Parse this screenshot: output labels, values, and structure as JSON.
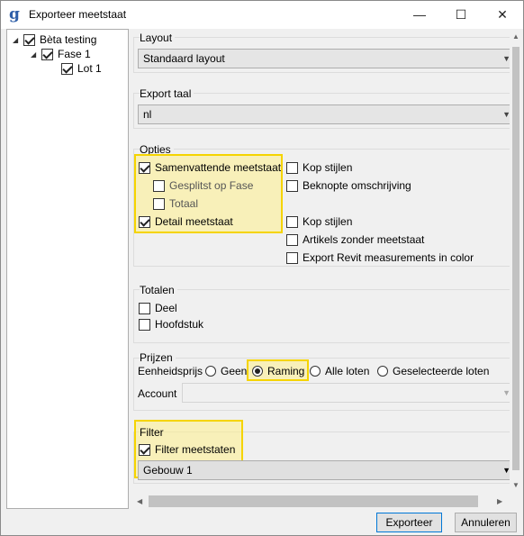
{
  "window": {
    "title": "Exporteer meetstaat",
    "icon": "g-app-icon",
    "controls": {
      "minimize": "—",
      "maximize": "☐",
      "close": "✕"
    }
  },
  "tree": {
    "items": [
      {
        "label": "Bèta testing",
        "checked": true,
        "expanded": true
      },
      {
        "label": "Fase 1",
        "checked": true,
        "expanded": true
      },
      {
        "label": "Lot 1",
        "checked": true
      }
    ]
  },
  "layout": {
    "label": "Layout",
    "selected": "Standaard layout"
  },
  "export_language": {
    "label": "Export taal",
    "selected": "nl"
  },
  "options": {
    "label": "Opties",
    "left": [
      {
        "label": "Samenvattende meetstaat",
        "checked": true
      },
      {
        "label": "Gesplitst op Fase",
        "checked": false,
        "disabled": true
      },
      {
        "label": "Totaal",
        "checked": false,
        "disabled": true
      },
      {
        "label": "Detail meetstaat",
        "checked": true
      }
    ],
    "right": [
      {
        "label": "Kop stijlen",
        "checked": false
      },
      {
        "label": "Beknopte omschrijving",
        "checked": false
      },
      {
        "label": "Kop stijlen",
        "checked": false
      },
      {
        "label": "Artikels zonder meetstaat",
        "checked": false
      },
      {
        "label": "Export Revit measurements in color",
        "checked": false
      }
    ]
  },
  "totals": {
    "label": "Totalen",
    "items": [
      {
        "label": "Deel",
        "checked": false
      },
      {
        "label": "Hoofdstuk",
        "checked": false
      }
    ]
  },
  "prices": {
    "label": "Prijzen",
    "unit_price_label": "Eenheidsprijs",
    "options": [
      {
        "label": "Geen",
        "selected": false
      },
      {
        "label": "Raming",
        "selected": true
      },
      {
        "label": "Alle loten",
        "selected": false
      },
      {
        "label": "Geselecteerde loten",
        "selected": false
      }
    ],
    "account_label": "Account",
    "account_value": ""
  },
  "filter": {
    "label": "Filter",
    "checkbox_label": "Filter meetstaten",
    "checked": true,
    "selected": "Gebouw 1"
  },
  "buttons": {
    "export": "Exporteer",
    "cancel": "Annuleren"
  },
  "colors": {
    "highlight": "#f5d400",
    "accent": "#0078d7"
  }
}
